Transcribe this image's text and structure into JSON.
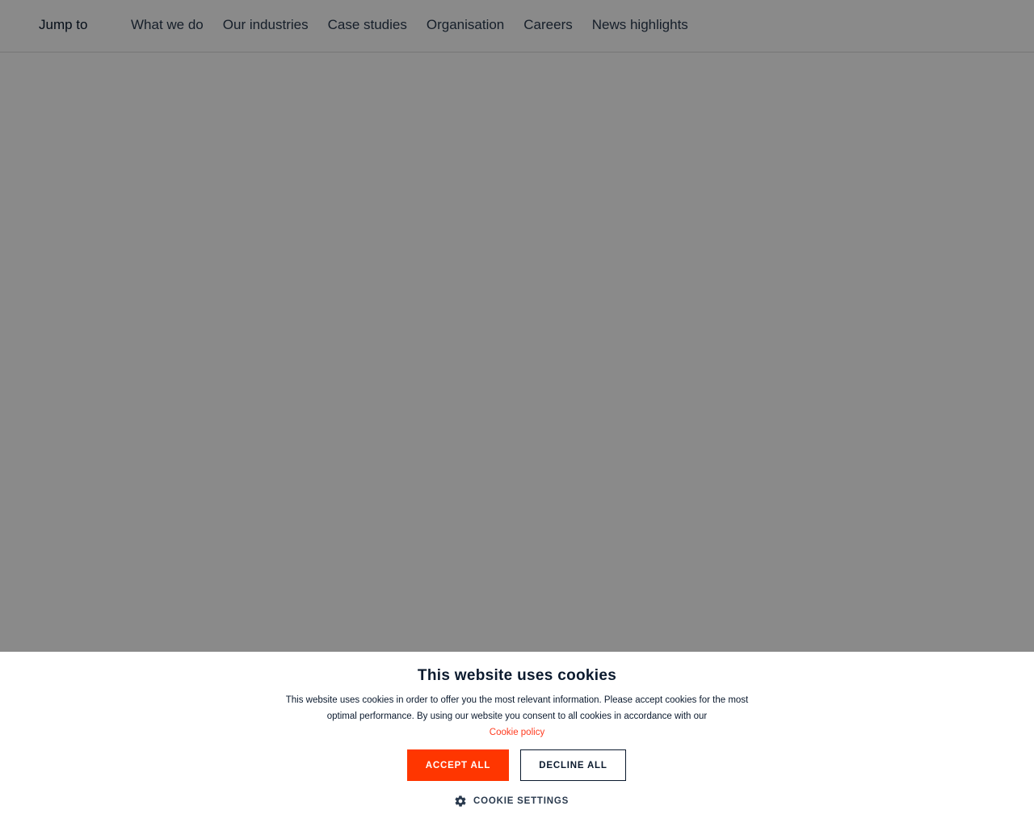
{
  "nav": {
    "jump_to": "Jump to",
    "links": [
      "What we do",
      "Our industries",
      "Case studies",
      "Organisation",
      "Careers",
      "News highlights"
    ]
  },
  "cookie": {
    "title": "This website uses cookies",
    "body": "This website uses cookies in order to offer you the most relevant information. Please accept cookies for the most optimal performance. By using our website you consent to all cookies in accordance with our",
    "policy_link": "Cookie policy",
    "accept_label": "ACCEPT ALL",
    "decline_label": "DECLINE ALL",
    "settings_label": "COOKIE SETTINGS",
    "settings_icon": "gear-icon"
  },
  "colors": {
    "accent": "#ff3600",
    "link": "#ff3b1f",
    "text_dark": "#0b1a2e"
  }
}
